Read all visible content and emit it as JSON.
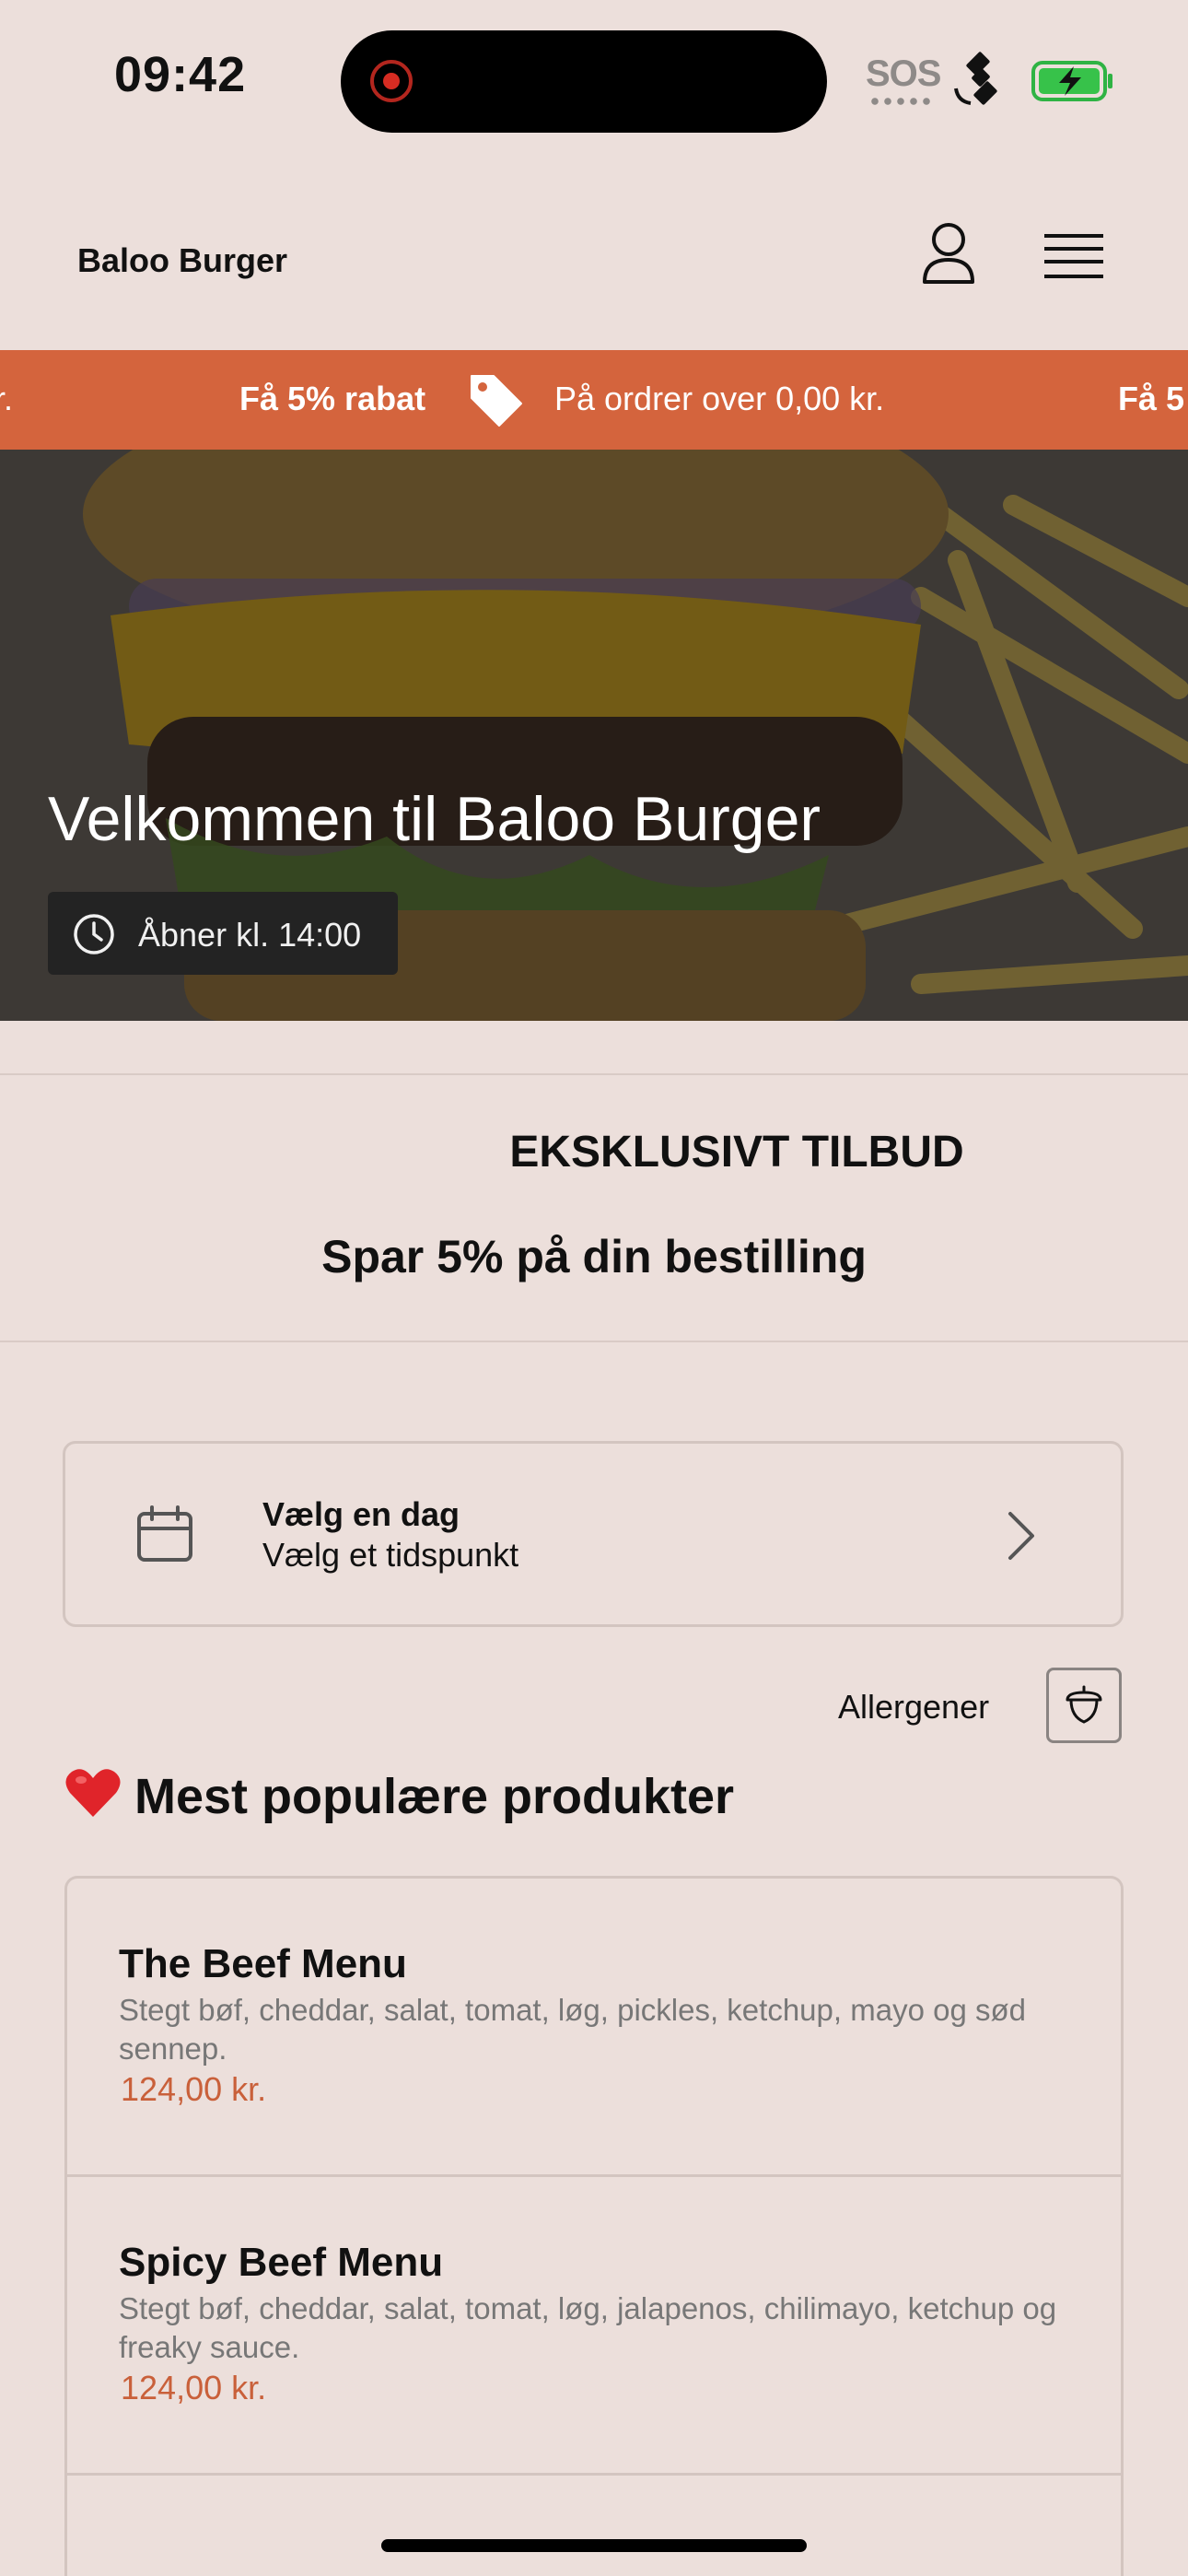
{
  "status_bar": {
    "time": "09:42",
    "sos": "SOS",
    "icons": [
      "recording-indicator",
      "satellite-icon",
      "battery-charging-icon"
    ]
  },
  "header": {
    "brand": "Baloo Burger",
    "icons": [
      "user-icon",
      "menu-icon"
    ]
  },
  "banner": {
    "left_fragment": "r.",
    "bold_text": "Få 5% rabat",
    "text": "På ordrer over 0,00 kr.",
    "right_fragment": "Få 5",
    "background_color": "#d4643d"
  },
  "hero": {
    "title": "Velkommen til Baloo Burger",
    "opening_hours": "Åbner kl. 14:00"
  },
  "offer": {
    "label": "EKSKLUSIVT TILBUD",
    "title": "Spar 5% på din bestilling"
  },
  "date_picker": {
    "title": "Vælg en dag",
    "subtitle": "Vælg et tidspunkt"
  },
  "allergens": {
    "label": "Allergener"
  },
  "popular": {
    "title": "Mest populære produkter",
    "products": [
      {
        "name": "The Beef Menu",
        "description": "Stegt bøf, cheddar, salat, tomat, løg, pickles, ketchup, mayo og sød sennep.",
        "price": "124,00 kr."
      },
      {
        "name": "Spicy Beef Menu",
        "description": "Stegt bøf, cheddar, salat, tomat, løg, jalapenos, chilimayo, ketchup og freaky sauce.",
        "price": "124,00 kr."
      }
    ]
  },
  "colors": {
    "accent": "#d4643d",
    "price": "#c9603a",
    "background": "#ecdfdb"
  }
}
